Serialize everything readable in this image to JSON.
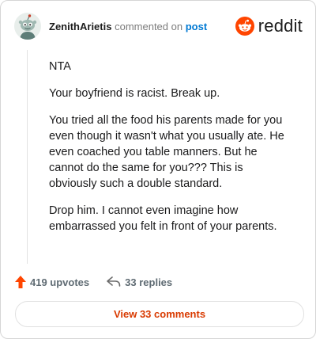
{
  "header": {
    "username": "ZenithArietis",
    "commented_text": "commented on",
    "post_link": "post",
    "brand": "reddit"
  },
  "comment": {
    "paragraphs": [
      "NTA",
      "Your boyfriend is racist. Break up.",
      "You tried all the food his parents made for you even though it wasn't what you usually ate. He even coached you table manners. But he cannot do the same for you??? This is obviously such a double standard.",
      "Drop him. I cannot even imagine how embarrassed you felt in front of your parents."
    ]
  },
  "actions": {
    "upvotes": "419 upvotes",
    "replies": "33 replies"
  },
  "view_comments_label": "View 33 comments",
  "colors": {
    "accent": "#ff4500",
    "link": "#0079d3",
    "button_text": "#d93a00"
  },
  "icons": {
    "avatar": "snoo-avatar",
    "logo": "reddit-logo-icon",
    "upvote": "upvote-arrow-icon",
    "reply": "reply-arrow-icon"
  }
}
